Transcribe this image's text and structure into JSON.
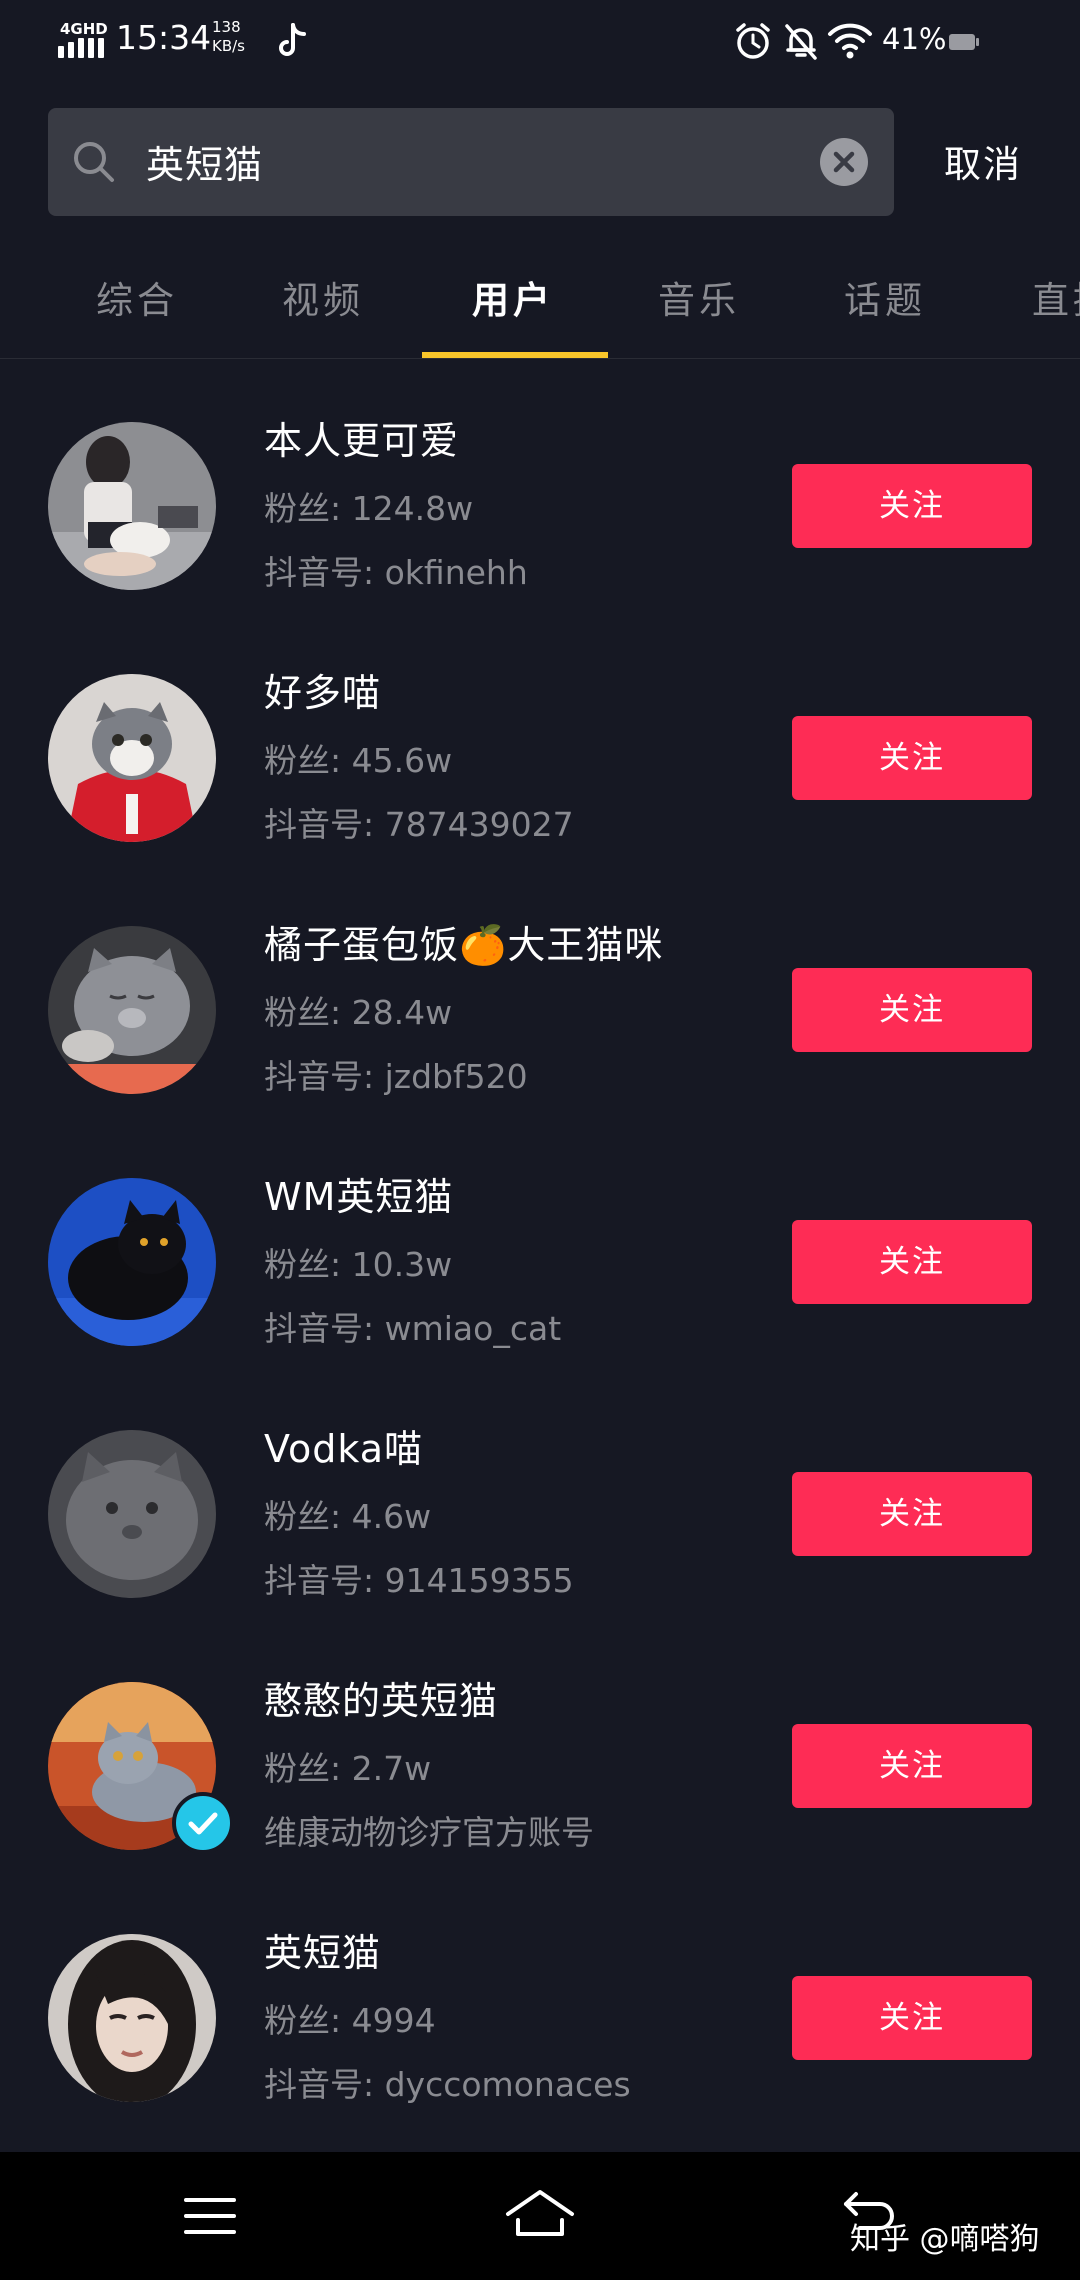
{
  "status_bar": {
    "network": "4GHD",
    "time": "15:34",
    "speed_value": "138",
    "speed_unit": "KB/s",
    "battery": "41%"
  },
  "search": {
    "query": "英短猫",
    "cancel_label": "取消"
  },
  "tabs": [
    {
      "label": "综合"
    },
    {
      "label": "视频"
    },
    {
      "label": "用户"
    },
    {
      "label": "音乐"
    },
    {
      "label": "话题"
    },
    {
      "label": "直播"
    }
  ],
  "active_tab": "用户",
  "users": [
    {
      "name": "本人更可爱",
      "fans": "粉丝: 124.8w",
      "id": "抖音号: okfinehh",
      "follow": "关注"
    },
    {
      "name": "好多喵",
      "fans": "粉丝: 45.6w",
      "id": "抖音号: 787439027",
      "follow": "关注"
    },
    {
      "name": "橘子蛋包饭🍊大王猫咪",
      "fans": "粉丝: 28.4w",
      "id": "抖音号: jzdbf520",
      "follow": "关注"
    },
    {
      "name": "WM英短猫",
      "fans": "粉丝: 10.3w",
      "id": "抖音号: wmiao_cat",
      "follow": "关注"
    },
    {
      "name": "Vodka喵",
      "fans": "粉丝: 4.6w",
      "id": "抖音号: 914159355",
      "follow": "关注"
    },
    {
      "name": "憨憨的英短猫",
      "fans": "粉丝: 2.7w",
      "id": "维康动物诊疗官方账号",
      "follow": "关注"
    },
    {
      "name": "英短猫",
      "fans": "粉丝: 4994",
      "id": "抖音号: dyccomonaces",
      "follow": "关注"
    }
  ],
  "watermark": "知乎 @嘀嗒狗",
  "colors": {
    "background": "#161823",
    "follow_button": "#fe2c55",
    "tab_indicator": "#f8c52a",
    "verified_badge": "#25c6e8"
  }
}
